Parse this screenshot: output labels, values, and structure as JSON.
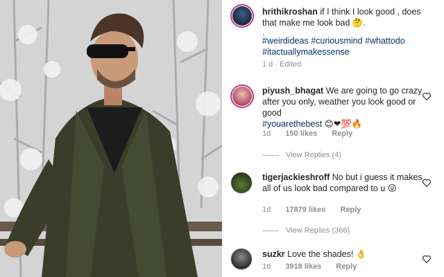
{
  "post": {
    "username": "hrithikroshan",
    "caption": "if I think I look good , does that make me look bad 🤔.",
    "dot": ".",
    "hashtags": [
      "#weirdideas",
      "#curiousmind",
      "#whattodo",
      "#itactuallymakessense"
    ],
    "time": "1 d · Edited"
  },
  "comments": [
    {
      "username": "piyush_bhagat",
      "text": "We are going to go crazy after you only, weather you look good or good",
      "hashtag": "#youarethebest",
      "emojis": "😊❤💯🔥",
      "time": "1d",
      "likes": "150 likes",
      "reply": "Reply",
      "view_replies": "View Replies (4)"
    },
    {
      "username": "tigerjackieshroff",
      "text": "No but i guess it makes all of us look bad compared to u",
      "emojis": "😜",
      "time": "1d",
      "likes": "17879 likes",
      "reply": "Reply",
      "view_replies": "View Replies (366)"
    },
    {
      "username": "suzkr",
      "text": "Love the shades! 👌",
      "time": "1d",
      "likes": "3918 likes",
      "reply": "Reply"
    }
  ],
  "icons": {
    "heart": "heart-icon",
    "avatar": "avatar"
  },
  "colors": {
    "hashtag": "#003569",
    "meta": "#8e8e8e",
    "story_ring": "#c13584"
  }
}
